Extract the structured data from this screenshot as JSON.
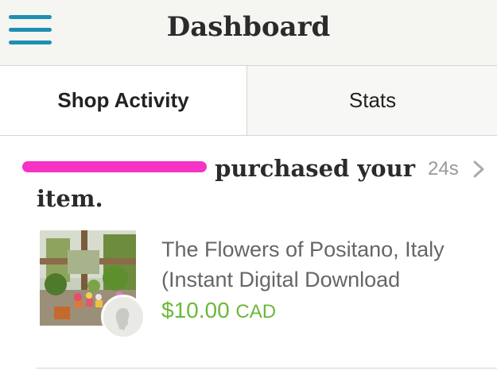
{
  "header": {
    "title": "Dashboard",
    "menu_icon": "hamburger-menu-icon"
  },
  "tabs": [
    {
      "label": "Shop Activity",
      "active": true
    },
    {
      "label": "Stats",
      "active": false
    }
  ],
  "activity": {
    "headline_suffix": "purchased your item.",
    "time": "24s",
    "item_title": "The Flowers of Positano, Italy (Instant Digital Download",
    "price": "$10.00",
    "currency": "CAD",
    "colors": {
      "accent": "#1f8fb0",
      "price": "#6cb83a",
      "redaction": "#f533c4"
    }
  }
}
